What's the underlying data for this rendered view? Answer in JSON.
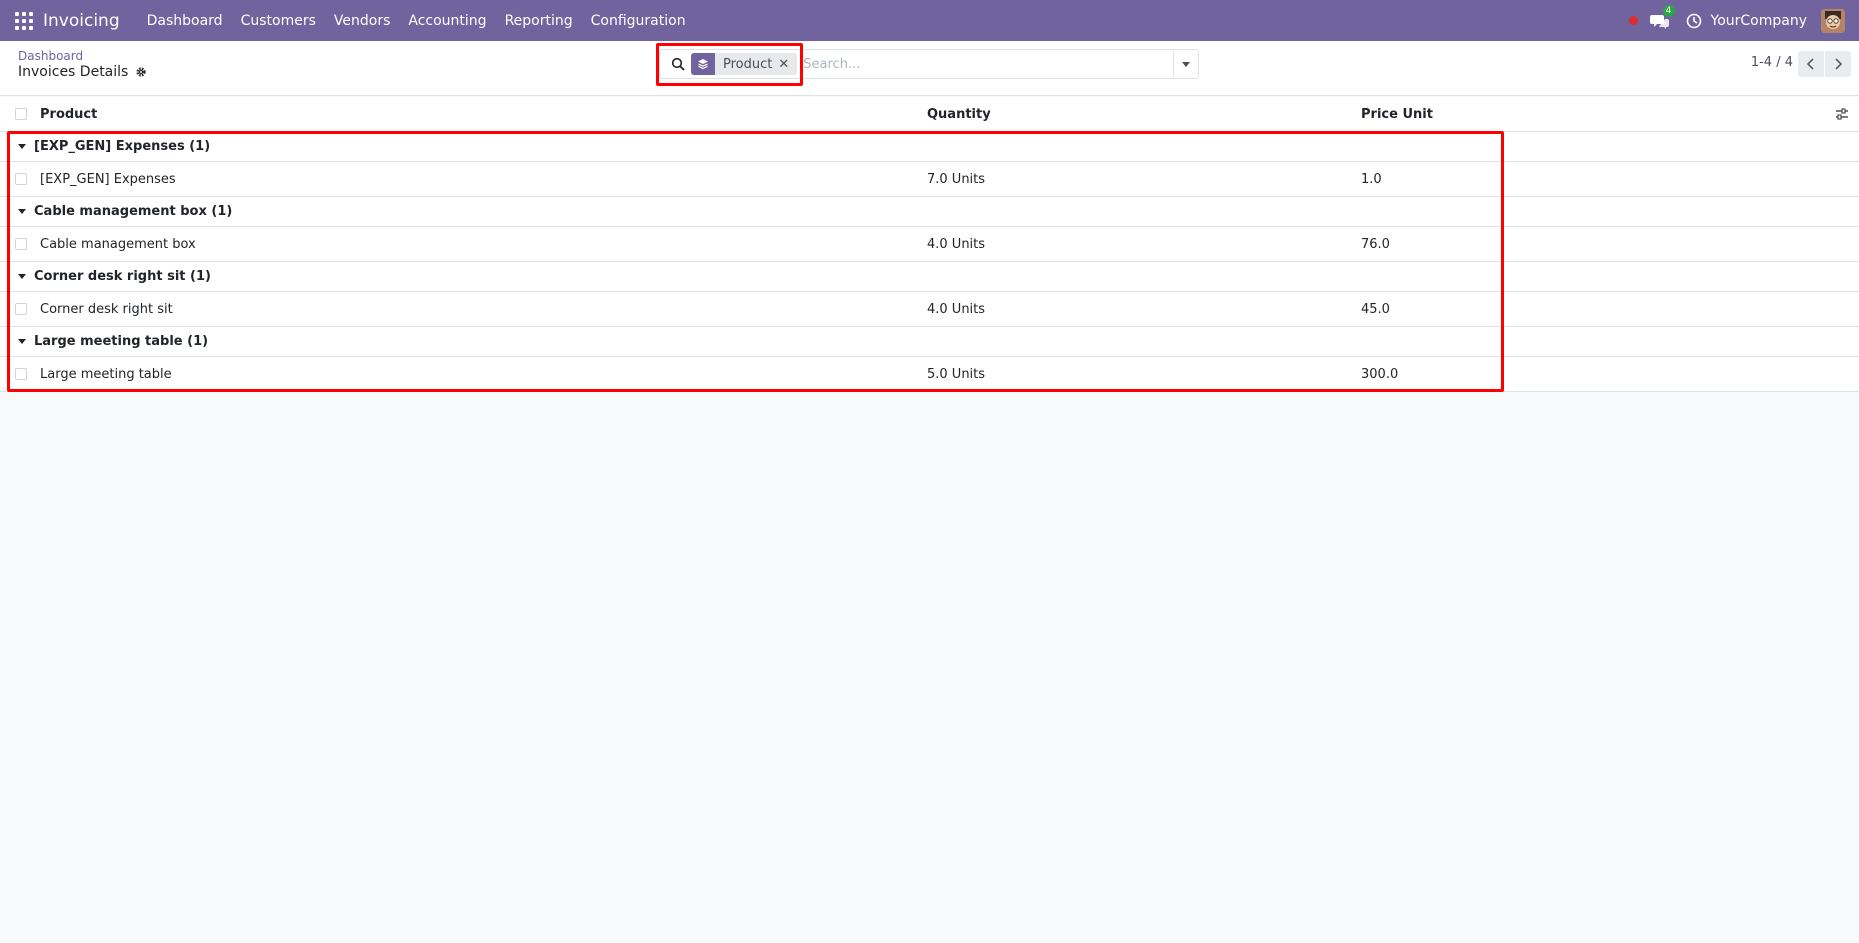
{
  "navbar": {
    "app_name": "Invoicing",
    "menu": [
      "Dashboard",
      "Customers",
      "Vendors",
      "Accounting",
      "Reporting",
      "Configuration"
    ],
    "chat_count": "4",
    "company": "YourCompany",
    "colors": {
      "bar": "#71639e",
      "activity_dot": "#e02b2b",
      "badge": "#28a745"
    }
  },
  "breadcrumb": {
    "parent": "Dashboard",
    "current": "Invoices Details"
  },
  "search": {
    "facet_icon": "layers-icon",
    "facet_label": "Product",
    "placeholder": "Search..."
  },
  "pager": {
    "text": "1-4 / 4"
  },
  "list": {
    "columns": [
      "Product",
      "Quantity",
      "Price Unit"
    ],
    "groups": [
      {
        "label": "[EXP_GEN] Expenses (1)",
        "rows": [
          {
            "product": "[EXP_GEN] Expenses",
            "quantity": "7.0 Units",
            "price_unit": "1.0"
          }
        ]
      },
      {
        "label": "Cable management box (1)",
        "rows": [
          {
            "product": "Cable management box",
            "quantity": "4.0 Units",
            "price_unit": "76.0"
          }
        ]
      },
      {
        "label": "Corner desk right sit (1)",
        "rows": [
          {
            "product": "Corner desk right sit",
            "quantity": "4.0 Units",
            "price_unit": "45.0"
          }
        ]
      },
      {
        "label": "Large meeting table (1)",
        "rows": [
          {
            "product": "Large meeting table",
            "quantity": "5.0 Units",
            "price_unit": "300.0"
          }
        ]
      }
    ]
  },
  "annotation_color": "#ff0000"
}
